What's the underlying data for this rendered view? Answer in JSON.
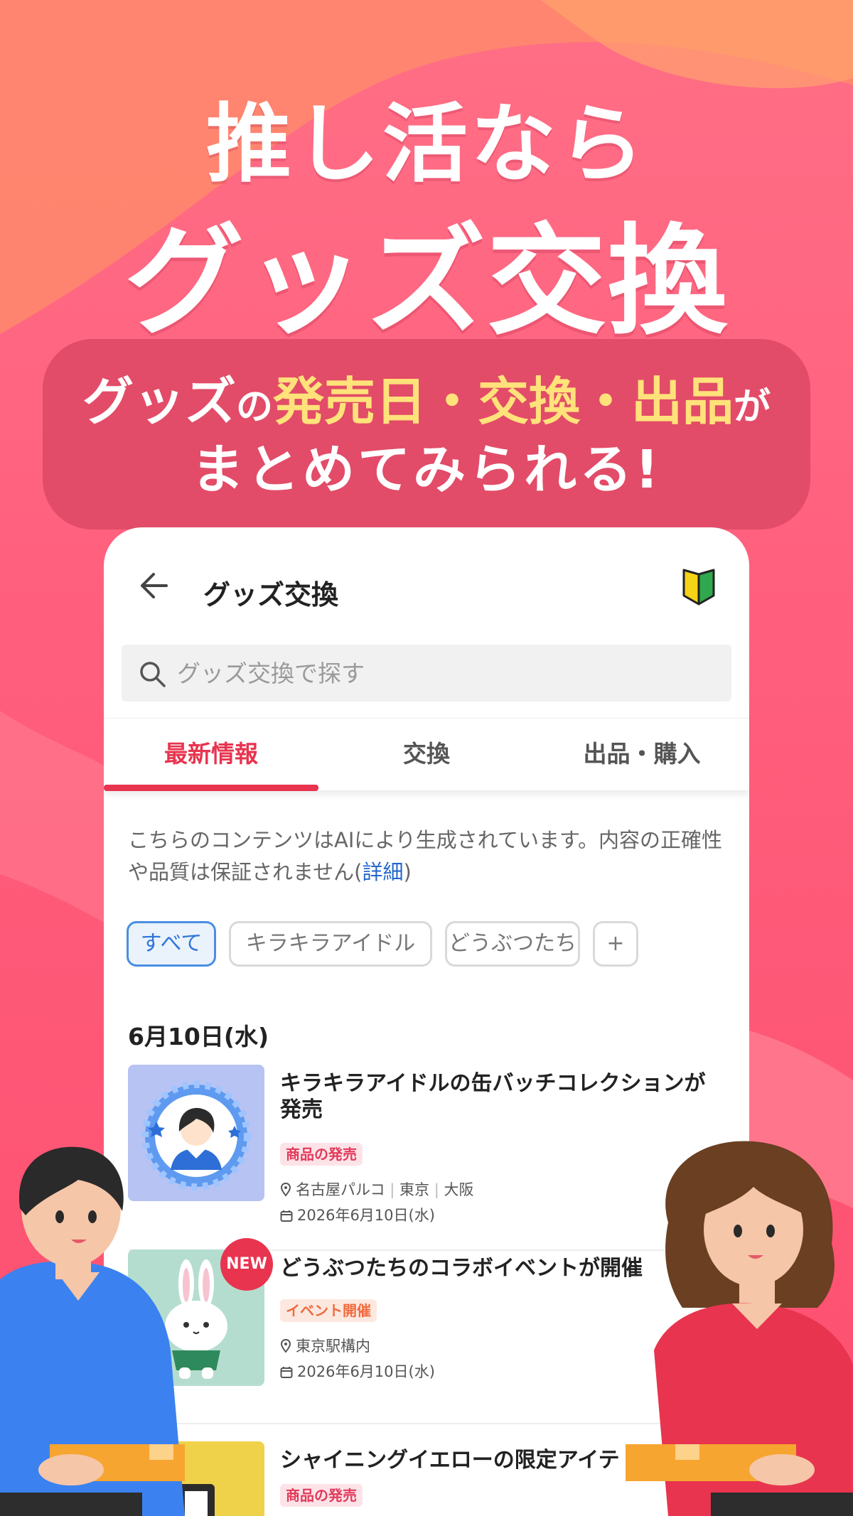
{
  "headline": {
    "line1": "推し活なら",
    "line2": "グッズ交換"
  },
  "bubble": {
    "part_goods": "グッズ",
    "part_no": "の",
    "part_highlight": "発売日・交換・出品",
    "part_ga": "が",
    "line2": "まとめてみられる!"
  },
  "app": {
    "title": "グッズ交換",
    "icons": {
      "back": "back-arrow-icon",
      "beginner": "beginner-mark-icon",
      "search": "search-icon"
    },
    "search_placeholder": "グッズ交換で探す",
    "tabs": [
      {
        "label": "最新情報",
        "active": true
      },
      {
        "label": "交換",
        "active": false
      },
      {
        "label": "出品・購入",
        "active": false
      }
    ],
    "notice_text": "こちらのコンテンツはAIにより生成されています。内容の正確性や品質は保証されません(",
    "notice_link": "詳細",
    "notice_end": ")",
    "filters": [
      {
        "label": "すべて",
        "active": true
      },
      {
        "label": "キラキラアイドル",
        "active": false
      },
      {
        "label": "どうぶつたち",
        "active": false
      },
      {
        "label": "+",
        "active": false
      }
    ],
    "date_heading": "6月10日(水)",
    "new_badge": "NEW",
    "items": [
      {
        "title": "キラキラアイドルの缶バッチコレクションが発売",
        "tag": "商品の発売",
        "tag_type": "product",
        "locations": [
          "名古屋パルコ",
          "東京",
          "大阪"
        ],
        "date": "2026年6月10日(水)"
      },
      {
        "title": "どうぶつたちのコラボイベントが開催",
        "tag": "イベント開催",
        "tag_type": "event",
        "locations": [
          "東京駅構内"
        ],
        "date": "2026年6月10日(水)"
      },
      {
        "title": "シャイニングイエローの限定アイテ",
        "tag": "商品の発売",
        "tag_type": "product"
      }
    ]
  },
  "colors": {
    "background": "#ff6f86",
    "accent_red": "#e8344f",
    "bubble": "#e24c68",
    "highlight_yellow": "#ffe27a",
    "link_blue": "#2266cc"
  }
}
